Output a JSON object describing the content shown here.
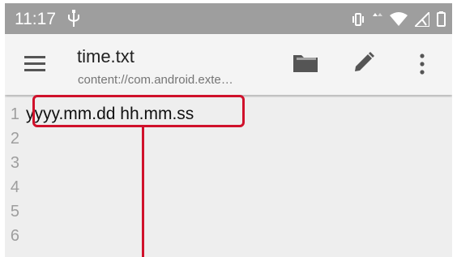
{
  "status_bar": {
    "time": "11:17",
    "icons": [
      "usb-icon",
      "vibrate-icon",
      "data-arrows-icon",
      "wifi-icon",
      "signal-icon",
      "battery-icon"
    ]
  },
  "app_bar": {
    "title": "time.txt",
    "subtitle": "content://com.android.exte…",
    "icons": [
      "menu-icon",
      "folder-icon",
      "pencil-icon",
      "more-vert-icon"
    ]
  },
  "editor": {
    "line_numbers": [
      "1",
      "2",
      "3",
      "4",
      "5",
      "6"
    ],
    "lines": [
      "yyyy.mm.dd hh.mm.ss",
      "",
      "",
      "",
      "",
      ""
    ]
  },
  "colors": {
    "status_bar": "#9e9e9e",
    "app_bar": "#f4f4f4",
    "editor_bg": "#eeeeee",
    "annotation": "#d0112b"
  }
}
